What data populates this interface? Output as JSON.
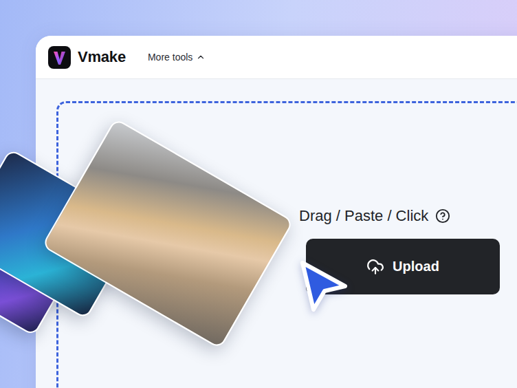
{
  "app": {
    "logo": {
      "name": "Vmake"
    },
    "menu": {
      "label": "More tools",
      "expanded": true
    }
  },
  "upload": {
    "hint": "Drag / Paste / Click",
    "button": "Upload"
  }
}
